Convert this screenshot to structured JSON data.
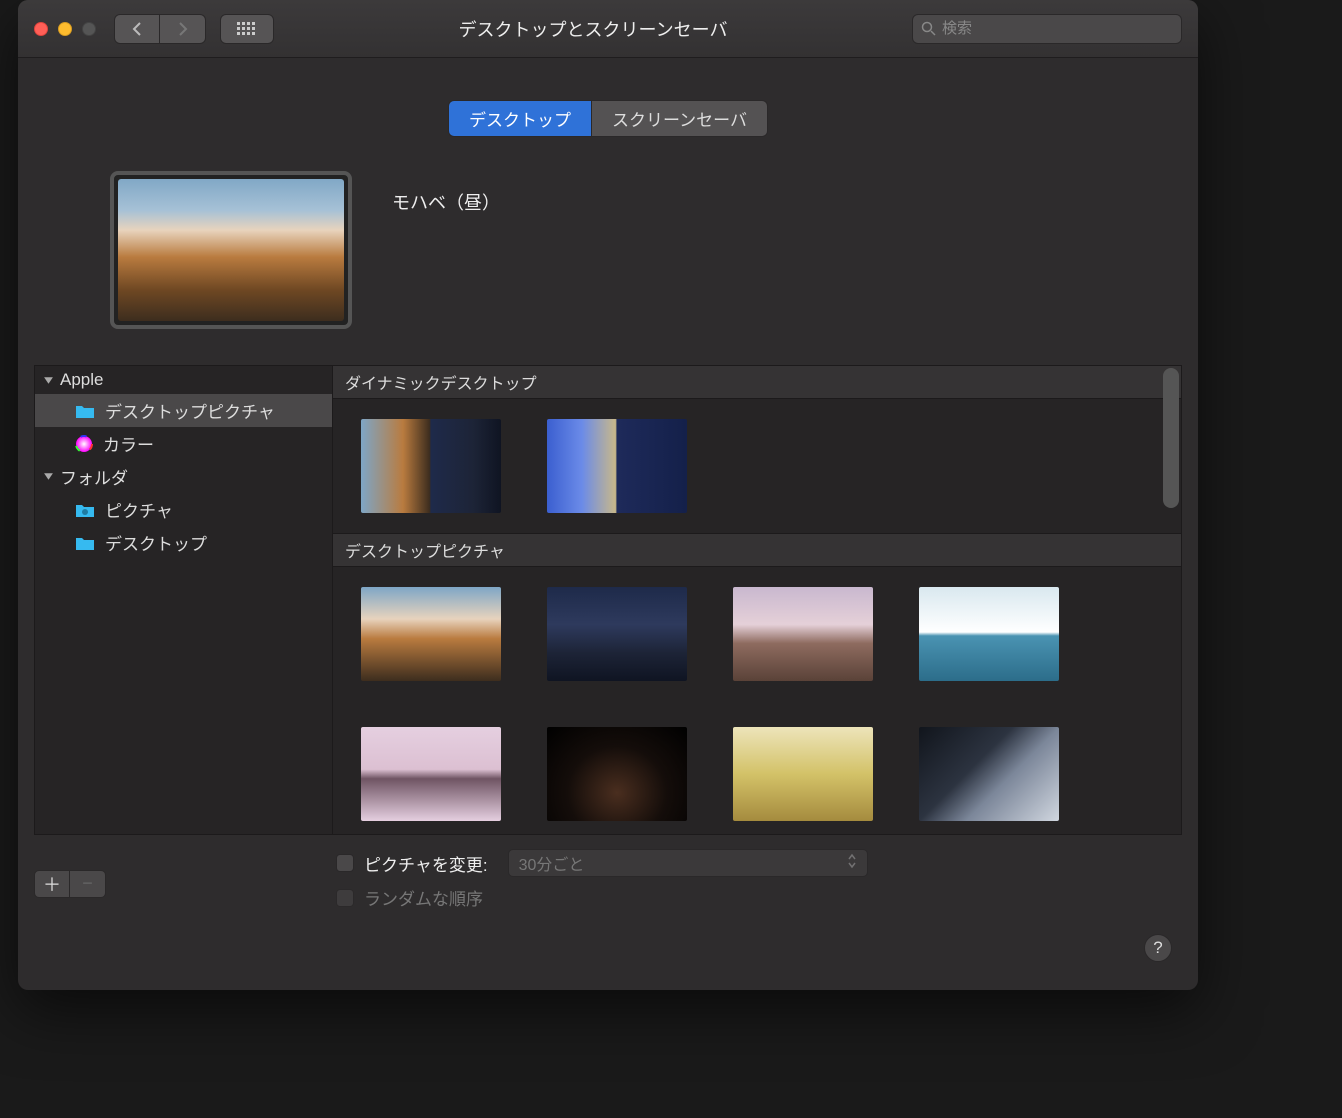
{
  "window": {
    "title": "デスクトップとスクリーンセーバ",
    "search_placeholder": "検索"
  },
  "tabs": [
    {
      "label": "デスクトップ",
      "active": true
    },
    {
      "label": "スクリーンセーバ",
      "active": false
    }
  ],
  "current_wallpaper": "モハベ（昼）",
  "sidebar": {
    "groups": [
      {
        "label": "Apple",
        "items": [
          {
            "label": "デスクトップピクチャ",
            "icon": "folder",
            "selected": true
          },
          {
            "label": "カラー",
            "icon": "colorwheel",
            "selected": false
          }
        ]
      },
      {
        "label": "フォルダ",
        "items": [
          {
            "label": "ピクチャ",
            "icon": "folder-img",
            "selected": false
          },
          {
            "label": "デスクトップ",
            "icon": "folder",
            "selected": false
          }
        ]
      }
    ]
  },
  "gallery": {
    "sections": [
      {
        "title": "ダイナミックデスクトップ"
      },
      {
        "title": "デスクトップピクチャ"
      }
    ]
  },
  "options": {
    "change_label": "ピクチャを変更:",
    "interval": "30分ごと",
    "random_label": "ランダムな順序"
  }
}
